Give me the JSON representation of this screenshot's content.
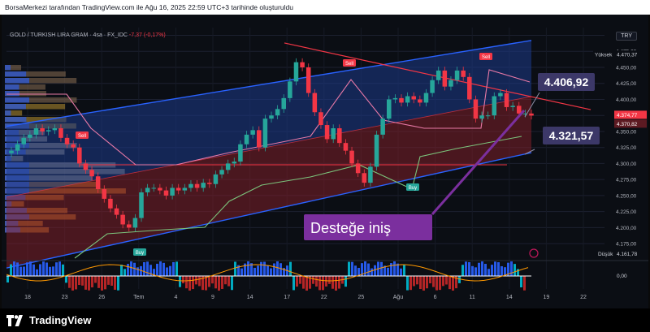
{
  "header": {
    "text": "BorsaMerkezi tarafından TradingView.com ile Ağu 16, 2025 22:59 UTC+3 tarihinde oluşturuldu"
  },
  "symbol": {
    "name": "GOLD / TURKISH LIRA GRAM · 4sa · FX_IDC",
    "change": "-7,37 (-0,17%)"
  },
  "currency": "TRY",
  "labels": {
    "high": {
      "text": "Yüksek",
      "value": "4.470,37"
    },
    "low": {
      "text": "Düşük",
      "value": "4.161,78"
    },
    "upper_callout": "4.406,92",
    "lower_callout": "4.321,57",
    "annotation": "Desteğe iniş",
    "price_last": "4.374,77",
    "price_prev": "4.370,82",
    "osc_zero": "0,00"
  },
  "signals": [
    {
      "text": "Sell",
      "color": "#f23645"
    },
    {
      "text": "Sell",
      "color": "#f23645"
    },
    {
      "text": "Sell",
      "color": "#f23645"
    },
    {
      "text": "Buy",
      "color": "#26a69a"
    },
    {
      "text": "Buy",
      "color": "#26a69a"
    }
  ],
  "footer": {
    "brand": "TradingView"
  },
  "colors": {
    "up": "#26a69a",
    "down": "#f23645",
    "channel": "#2962ff",
    "callout": "#3c3868",
    "annotation": "#7b2f9e"
  },
  "chart_data": {
    "type": "line",
    "title": "GOLD / TURKISH LIRA GRAM · 4sa · FX_IDC",
    "x_ticks": [
      "18",
      "23",
      "26",
      "Tem",
      "4",
      "9",
      "14",
      "17",
      "22",
      "25",
      "Ağu",
      "6",
      "11",
      "14",
      "19",
      "22"
    ],
    "y_ticks": [
      4175,
      4200,
      4225,
      4250,
      4275,
      4300,
      4325,
      4350,
      4375,
      4400,
      4425,
      4450,
      4475,
      4500
    ],
    "y_tick_labels": [
      "4.175,00",
      "4.200,00",
      "4.225,00",
      "4.250,00",
      "4.275,00",
      "4.300,00",
      "4.325,00",
      "4.350,00",
      "4.375,00",
      "4.400,00",
      "4.425,00",
      "4.450,00",
      "4.475,00",
      "4.500,00"
    ],
    "ylim": [
      4160,
      4512
    ],
    "series": [
      {
        "values": [
          4320,
          4330,
          4340,
          4345,
          4355,
          4350,
          4352,
          4355,
          4340,
          4330,
          4325,
          4300,
          4290,
          4280,
          4260,
          4245,
          4230,
          4220,
          4205,
          4200,
          4215,
          4255,
          4262,
          4262,
          4258,
          4250,
          4262,
          4258,
          4262,
          4268,
          4262,
          4270,
          4268,
          4283,
          4290,
          4300,
          4303,
          4330,
          4345,
          4352,
          4325,
          4370,
          4375,
          4385,
          4402,
          4428,
          4458,
          4450,
          4410,
          4380,
          4360,
          4338,
          4355,
          4332,
          4320,
          4300,
          4285,
          4270,
          4295,
          4345,
          4370,
          4400,
          4402,
          4395,
          4405,
          4400,
          4395,
          4410,
          4430,
          4445,
          4420,
          4430,
          4445,
          4435,
          4400,
          4370,
          4375,
          4375,
          4405,
          4410,
          4388,
          4390,
          4378,
          4378,
          4374.77
        ]
      }
    ],
    "high_value": 4470.37,
    "low_value": 4161.78,
    "last_value": 4374.77,
    "secondary_value": 4370.82,
    "upper_callout_value": 4406.92,
    "lower_callout_value": 4321.57,
    "horizontal_level": 4298,
    "channel": {
      "upper": [
        4358,
        4492
      ],
      "lower": [
        4137,
        4317
      ]
    },
    "trendline": [
      4488,
      4384
    ],
    "oscillator_zero": 0
  }
}
